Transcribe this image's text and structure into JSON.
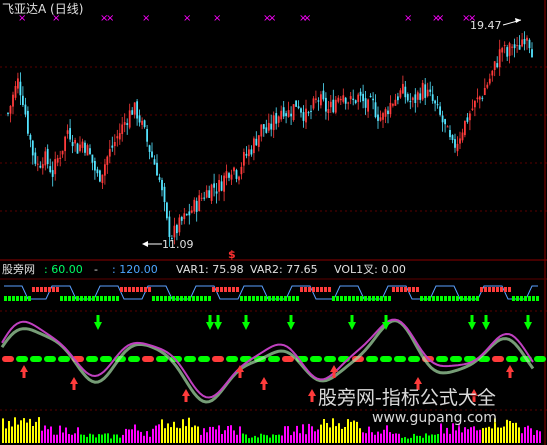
{
  "top_panel": {
    "title": "飞亚达A (日线)",
    "high_label": "19.47",
    "low_label": "11.09",
    "marker_symbol": "$",
    "cross_marker": "×"
  },
  "indicator_header": {
    "name": "股旁网",
    "value1": ": 60.00",
    "dash": "-",
    "value2": ": 120.00",
    "var1": "VAR1: 75.98",
    "var2": "VAR2: 77.65",
    "vol": "VOL1叉: 0.00"
  },
  "watermark": {
    "line1": "股旁网-指标公式大全",
    "line2": "www.gupang.com"
  },
  "colors": {
    "up": "#ff3b3b",
    "down": "#54e4ff",
    "grid": "#8b0000",
    "green": "#00ff00",
    "magenta": "#ff00ff",
    "yellow": "#ffff00",
    "white": "#ffffff"
  },
  "chart_data": {
    "type": "candlestick",
    "title": "飞亚达A (日线)",
    "annotations": [
      {
        "label": "19.47",
        "meaning": "period high"
      },
      {
        "label": "11.09",
        "meaning": "period low"
      }
    ],
    "close_path": [
      16.2,
      16.9,
      17.5,
      16.8,
      15.6,
      14.6,
      14.1,
      14.5,
      14.2,
      13.8,
      14.4,
      14.9,
      15.6,
      15.2,
      14.8,
      15.1,
      14.7,
      14.2,
      13.6,
      14.0,
      14.5,
      14.9,
      15.3,
      15.7,
      16.1,
      16.4,
      16.2,
      15.6,
      15.0,
      14.4,
      13.9,
      12.8,
      11.6,
      11.3,
      11.6,
      11.9,
      12.1,
      12.4,
      12.6,
      12.9,
      13.1,
      13.3,
      13.2,
      13.5,
      13.9,
      14.1,
      13.8,
      14.3,
      14.6,
      14.9,
      15.3,
      15.7,
      15.4,
      15.8,
      16.1,
      16.5,
      16.2,
      16.4,
      16.7,
      16.3,
      16.0,
      16.4,
      16.8,
      16.6,
      16.3,
      16.5,
      16.9,
      17.1,
      16.8,
      16.6,
      16.9,
      16.7,
      16.4,
      16.6,
      16.2,
      16.0,
      16.4,
      16.7,
      16.9,
      17.1,
      16.8,
      16.6,
      16.9,
      17.2,
      17.0,
      16.7,
      16.3,
      15.9,
      15.4,
      14.8,
      15.1,
      15.6,
      16.0,
      16.4,
      16.7,
      17.0,
      17.4,
      17.8,
      18.3,
      18.9,
      18.5,
      19.0,
      18.7,
      19.2,
      19.47,
      18.8
    ]
  }
}
